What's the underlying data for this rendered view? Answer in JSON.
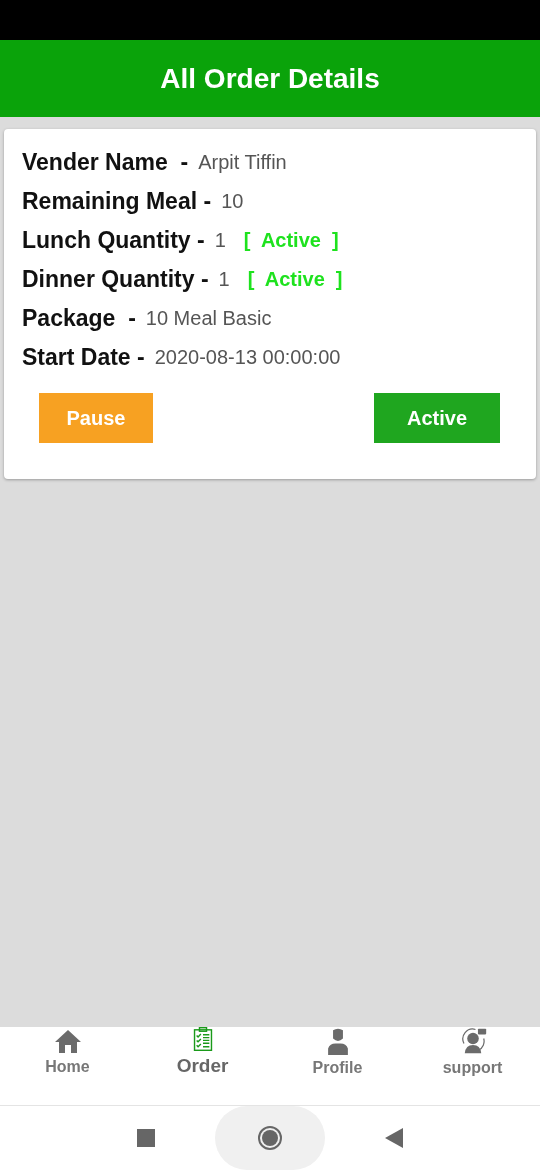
{
  "header": {
    "title": "All Order Details"
  },
  "order": {
    "fields": [
      {
        "label": "Vender Name  -",
        "value": "Arpit Tiffin"
      },
      {
        "label": "Remaining Meal -",
        "value": "10"
      },
      {
        "label": "Lunch Quantity -",
        "value": "1",
        "status": "[  Active  ]"
      },
      {
        "label": "Dinner Quantity -",
        "value": "1",
        "status": "[  Active  ]"
      },
      {
        "label": "Package  -",
        "value": "10 Meal Basic"
      },
      {
        "label": "Start Date -",
        "value": "2020-08-13 00:00:00"
      }
    ],
    "buttons": [
      {
        "label": "Pause",
        "kind": "pause"
      },
      {
        "label": "Active",
        "kind": "active"
      }
    ]
  },
  "bottom_nav": [
    {
      "label": "Home",
      "selected": false
    },
    {
      "label": "Order",
      "selected": true
    },
    {
      "label": "Profile",
      "selected": false
    },
    {
      "label": "support",
      "selected": false
    }
  ]
}
